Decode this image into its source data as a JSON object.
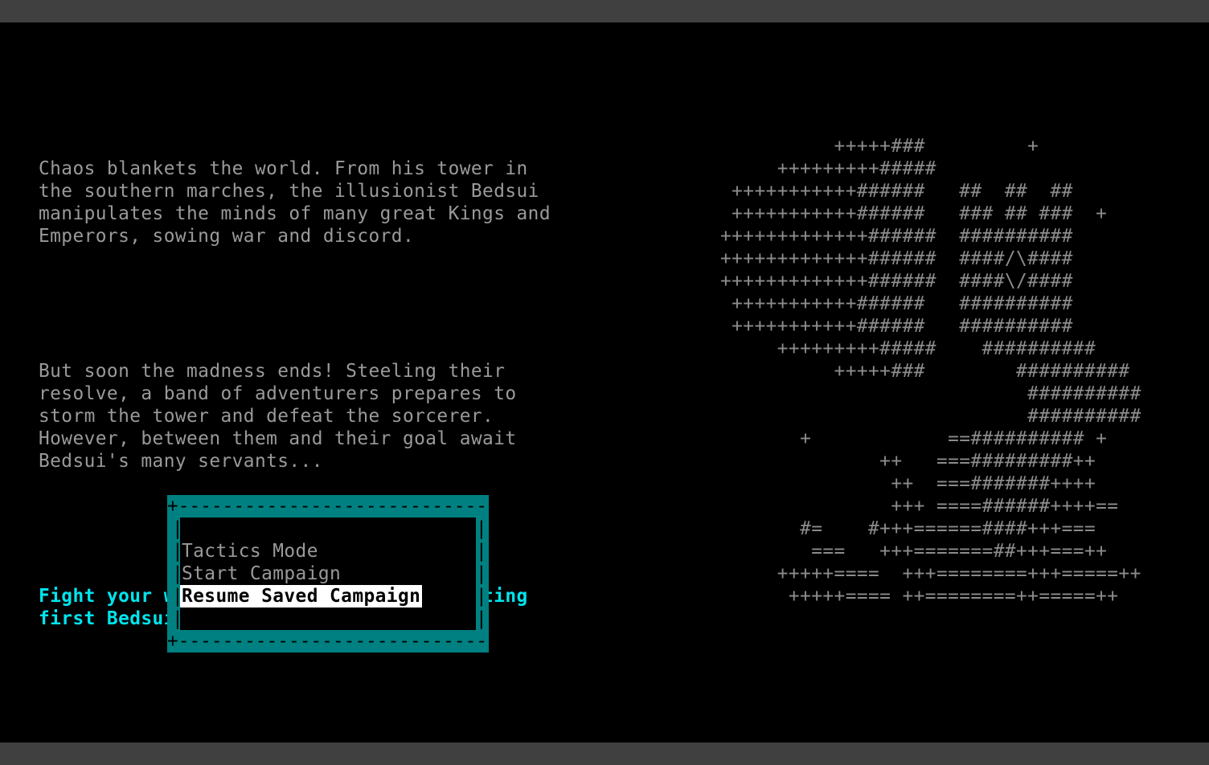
{
  "story": {
    "intro": "Chaos blankets the world. From his tower in\nthe southern marches, the illusionist Bedsui\nmanipulates the minds of many great Kings and\nEmperors, sowing war and discord.",
    "second": "But soon the madness ends! Steeling their\nresolve, a band of adventurers prepares to\nstorm the tower and defeat the sorcerer.\nHowever, between them and their goal await\nBedsui's many servants...",
    "goal": "Fight your way through the tower, defeating\nfirst Bedsui's lieutenants and then him"
  },
  "art": "          +++++###         +\n     +++++++++#####\n +++++++++++######   ##  ##  ##\n +++++++++++######   ### ## ###  +\n+++++++++++++######  ##########\n+++++++++++++######  ####/\\####\n+++++++++++++######  ####\\/####\n +++++++++++######   ##########\n +++++++++++######   ##########\n     +++++++++#####    ##########\n          +++++###        ##########\n                           ##########\n                           ##########\n       +            ==########## +\n              ++   ===#########++\n               ++  ===#######++++\n               +++ ====######++++==\n       #=    #+++======####+++===\n        ===   +++=======##+++===++\n     +++++====  +++========+++=====++\n      +++++==== ++========++=====++",
  "menu": {
    "items": [
      {
        "label": "Tactics Mode"
      },
      {
        "label": "Start Campaign"
      },
      {
        "label": "Resume Saved Campaign"
      }
    ],
    "selected_index": 2
  },
  "colors": {
    "story_text": "#9a9a9a",
    "goal_text": "#00e5ee",
    "menu_frame": "#008080",
    "selected_bg": "#ffffff"
  }
}
